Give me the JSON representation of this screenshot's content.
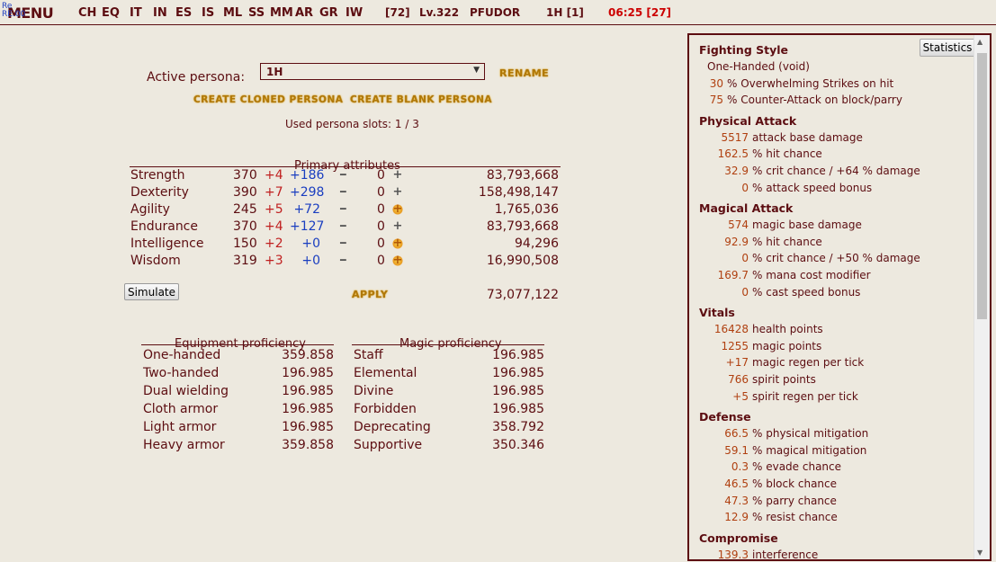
{
  "topbar": {
    "menu": "MENU",
    "overlay_line1": "Re",
    "overlay_line2": "RE.00",
    "nav": [
      "CH",
      "EQ",
      "IT",
      "IN",
      "ES",
      "IS",
      "ML",
      "SS",
      "MM",
      "AR",
      "GR",
      "IW"
    ],
    "stamina": "[72]",
    "level": "Lv.322",
    "player": "PFUDOR",
    "persona_slot": "1H [1]",
    "clock": "06:25 [27]"
  },
  "persona": {
    "label": "Active persona:",
    "selected": "1H",
    "rename": "RENAME",
    "create_cloned": "CREATE CLONED PERSONA",
    "create_blank": "CREATE BLANK PERSONA",
    "slots": "Used persona slots: 1 / 3"
  },
  "primary": {
    "title": "Primary attributes",
    "rows": [
      {
        "name": "Strength",
        "base": "370",
        "plus": "+4",
        "bonus": "+186",
        "zero": "0",
        "btn": "+",
        "gold": false,
        "exp": "83,793,668"
      },
      {
        "name": "Dexterity",
        "base": "390",
        "plus": "+7",
        "bonus": "+298",
        "zero": "0",
        "btn": "+",
        "gold": false,
        "exp": "158,498,147"
      },
      {
        "name": "Agility",
        "base": "245",
        "plus": "+5",
        "bonus": "+72",
        "zero": "0",
        "btn": "+",
        "gold": true,
        "exp": "1,765,036"
      },
      {
        "name": "Endurance",
        "base": "370",
        "plus": "+4",
        "bonus": "+127",
        "zero": "0",
        "btn": "+",
        "gold": false,
        "exp": "83,793,668"
      },
      {
        "name": "Intelligence",
        "base": "150",
        "plus": "+2",
        "bonus": "+0",
        "zero": "0",
        "btn": "+",
        "gold": true,
        "exp": "94,296"
      },
      {
        "name": "Wisdom",
        "base": "319",
        "plus": "+3",
        "bonus": "+0",
        "zero": "0",
        "btn": "+",
        "gold": true,
        "exp": "16,990,508"
      }
    ],
    "simulate": "Simulate",
    "apply": "APPLY",
    "total": "73,077,122"
  },
  "equipment": {
    "title": "Equipment proficiency",
    "rows": [
      {
        "name": "One-handed",
        "value": "359.858"
      },
      {
        "name": "Two-handed",
        "value": "196.985"
      },
      {
        "name": "Dual wielding",
        "value": "196.985"
      },
      {
        "name": "Cloth armor",
        "value": "196.985"
      },
      {
        "name": "Light armor",
        "value": "196.985"
      },
      {
        "name": "Heavy armor",
        "value": "359.858"
      }
    ]
  },
  "magic": {
    "title": "Magic proficiency",
    "rows": [
      {
        "name": "Staff",
        "value": "196.985"
      },
      {
        "name": "Elemental",
        "value": "196.985"
      },
      {
        "name": "Divine",
        "value": "196.985"
      },
      {
        "name": "Forbidden",
        "value": "196.985"
      },
      {
        "name": "Deprecating",
        "value": "358.792"
      },
      {
        "name": "Supportive",
        "value": "350.346"
      }
    ]
  },
  "stats": {
    "button": "Statistics",
    "fighting_style": {
      "title": "Fighting Style",
      "style": "One-Handed (void)",
      "lines": [
        {
          "num": "30",
          "text": "% Overwhelming Strikes on hit"
        },
        {
          "num": "75",
          "text": "% Counter-Attack on block/parry"
        }
      ]
    },
    "physical": {
      "title": "Physical Attack",
      "lines": [
        {
          "num": "5517",
          "text": "attack base damage"
        },
        {
          "num": "162.5",
          "text": "% hit chance"
        },
        {
          "num": "32.9",
          "text": "% crit chance / +64 % damage"
        },
        {
          "num": "0",
          "text": "% attack speed bonus"
        }
      ]
    },
    "magical": {
      "title": "Magical Attack",
      "lines": [
        {
          "num": "574",
          "text": "magic base damage"
        },
        {
          "num": "92.9",
          "text": "% hit chance"
        },
        {
          "num": "0",
          "text": "% crit chance / +50 % damage"
        },
        {
          "num": "169.7",
          "text": "% mana cost modifier"
        },
        {
          "num": "0",
          "text": "% cast speed bonus"
        }
      ]
    },
    "vitals": {
      "title": "Vitals",
      "lines": [
        {
          "num": "16428",
          "text": "health points"
        },
        {
          "num": "1255",
          "text": "magic points"
        },
        {
          "num": "+17",
          "text": "magic regen per tick"
        },
        {
          "num": "766",
          "text": "spirit points"
        },
        {
          "num": "+5",
          "text": "spirit regen per tick"
        }
      ]
    },
    "defense": {
      "title": "Defense",
      "lines": [
        {
          "num": "66.5",
          "text": "% physical mitigation"
        },
        {
          "num": "59.1",
          "text": "% magical mitigation"
        },
        {
          "num": "0.3",
          "text": "% evade chance"
        },
        {
          "num": "46.5",
          "text": "% block chance"
        },
        {
          "num": "47.3",
          "text": "% parry chance"
        },
        {
          "num": "12.9",
          "text": "% resist chance"
        }
      ]
    },
    "compromise": {
      "title": "Compromise",
      "lines": [
        {
          "num": "139.3",
          "text": "interference"
        }
      ]
    }
  }
}
